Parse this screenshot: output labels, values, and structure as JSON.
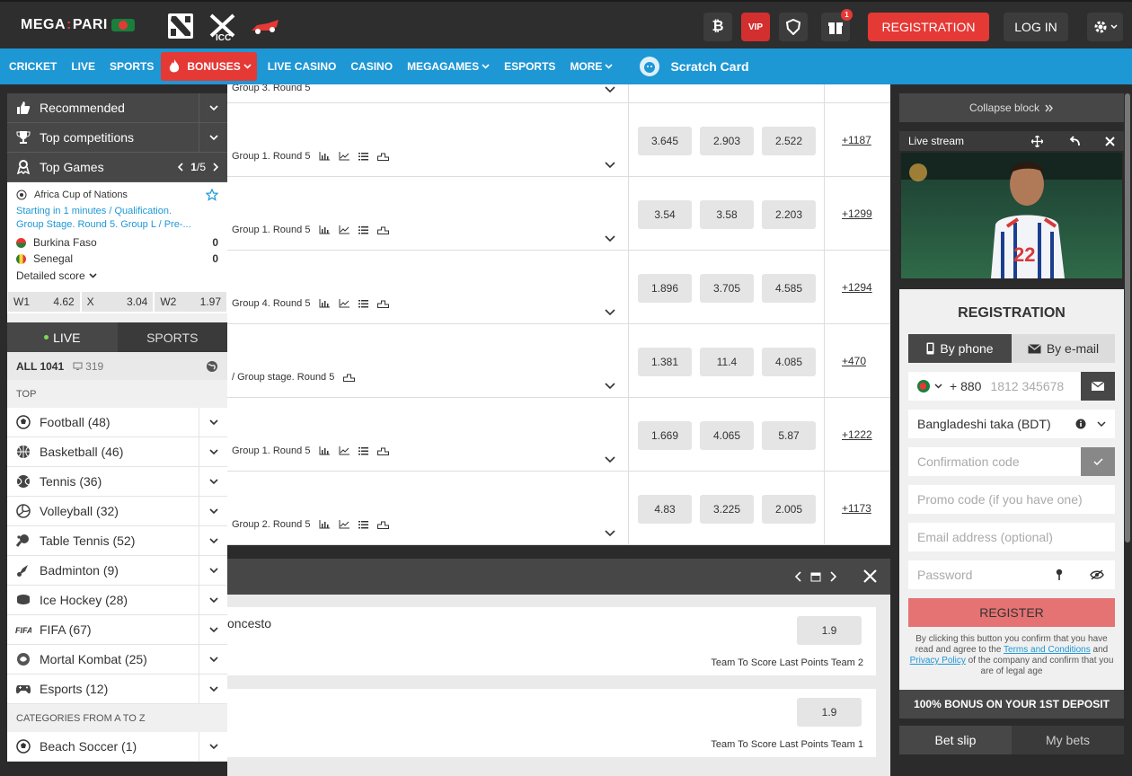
{
  "header": {
    "logo_left": "MEGA",
    "logo_right": "PARI",
    "vip": "VIP",
    "gift_count": "1",
    "registration": "REGISTRATION",
    "login": "LOG IN"
  },
  "nav": {
    "items": [
      "CRICKET",
      "LIVE",
      "SPORTS",
      "BONUSES",
      "LIVE CASINO",
      "CASINO",
      "MEGAGAMES",
      "ESPORTS",
      "MORE"
    ],
    "scratch": "Scratch Card"
  },
  "left": {
    "recommended": "Recommended",
    "top_competitions": "Top competitions",
    "top_games": "Top Games",
    "page_current": "1",
    "page_total": "/5",
    "match": {
      "league": "Africa Cup of Nations",
      "info1": "Starting in 1 minutes / Qualification.",
      "info2": "Group Stage. Round 5. Group L / Pre-...",
      "team1": "Burkina Faso",
      "score1": "0",
      "team2": "Senegal",
      "score2": "0",
      "detailed": "Detailed score",
      "w1_label": "W1",
      "w1": "4.62",
      "x_label": "X",
      "x": "3.04",
      "w2_label": "W2",
      "w2": "1.97"
    },
    "tab_live": "LIVE",
    "tab_sports": "SPORTS",
    "all_label": "ALL 1041",
    "all_screens": "319",
    "top_label": "TOP",
    "sports": [
      {
        "name": "Football (48)"
      },
      {
        "name": "Basketball (46)"
      },
      {
        "name": "Tennis (36)"
      },
      {
        "name": "Volleyball (32)"
      },
      {
        "name": "Table Tennis (52)"
      },
      {
        "name": "Badminton (9)"
      },
      {
        "name": "Ice Hockey (28)"
      },
      {
        "name": "FIFA (67)"
      },
      {
        "name": "Mortal Kombat (25)"
      },
      {
        "name": "Esports (12)"
      }
    ],
    "categories_label": "CATEGORIES FROM A TO Z",
    "beach": "Beach Soccer (1)"
  },
  "center": {
    "top_partial": "Group 3. Round 5",
    "rows": [
      {
        "label": "Group 1. Round 5",
        "o1": "3.645",
        "o2": "2.903",
        "o3": "2.522",
        "more": "+1187"
      },
      {
        "label": "Group 1. Round 5",
        "o1": "3.54",
        "o2": "3.58",
        "o3": "2.203",
        "more": "+1299"
      },
      {
        "label": "Group 4. Round 5",
        "o1": "1.896",
        "o2": "3.705",
        "o3": "4.585",
        "more": "+1294"
      },
      {
        "label": "/ Group stage. Round 5",
        "o1": "1.381",
        "o2": "11.4",
        "o3": "4.085",
        "more": "+470"
      },
      {
        "label": "Group 1. Round 5",
        "o1": "1.669",
        "o2": "4.065",
        "o3": "5.87",
        "more": "+1222"
      },
      {
        "label": "Group 2. Round 5",
        "o1": "4.83",
        "o2": "3.225",
        "o3": "2.005",
        "more": "+1173"
      }
    ]
  },
  "calendar": {
    "card1_title": "oncesto",
    "card1_odd": "1.9",
    "card1_market": "Team To Score Last Points Team 2",
    "card2_odd": "1.9",
    "card2_market": "Team To Score Last Points Team 1"
  },
  "right": {
    "collapse": "Collapse block",
    "live_stream": "Live stream",
    "jersey_number": "22",
    "reg_title": "REGISTRATION",
    "by_phone": "By phone",
    "by_email": "By e-mail",
    "phone_code": "+ 880",
    "phone_placeholder": "1812 345678",
    "currency": "Bangladeshi taka (BDT)",
    "confirmation": "Confirmation code",
    "promo": "Promo code (if you have one)",
    "email": "Email address (optional)",
    "password": "Password",
    "register": "REGISTER",
    "legal_1": "By clicking this button you confirm that you have read and agree to the",
    "legal_terms": "Terms and Conditions",
    "legal_2": "and",
    "legal_privacy": "Privacy Policy",
    "legal_3": "of the company and confirm that you are of legal age",
    "bonus": "100% BONUS ON YOUR 1ST DEPOSIT",
    "bet_slip": "Bet slip",
    "my_bets": "My bets"
  }
}
